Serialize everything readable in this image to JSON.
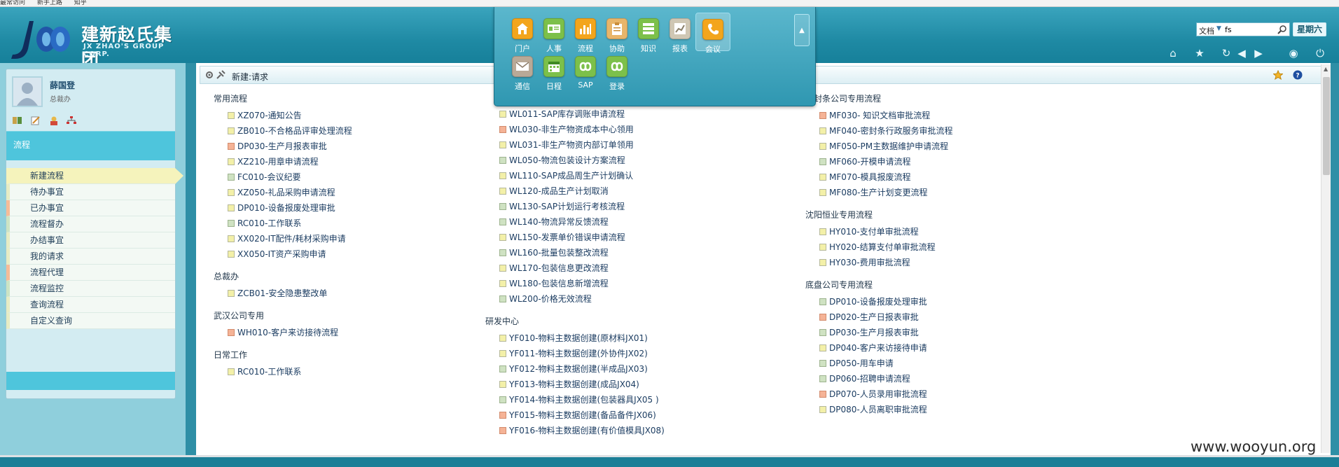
{
  "bookmarks": [
    "最常访问",
    "新手上路",
    "知乎"
  ],
  "logo": {
    "cn": "建新赵氏集团",
    "en": "JX ZHAO'S GROUP CORP."
  },
  "modules": [
    {
      "label": "门户",
      "icon": "home-icon",
      "color": "#f3a51c"
    },
    {
      "label": "人事",
      "icon": "id-card-icon",
      "color": "#7cc04a"
    },
    {
      "label": "流程",
      "icon": "bar-chart-icon",
      "color": "#f3a51c"
    },
    {
      "label": "协助",
      "icon": "clipboard-icon",
      "color": "#e8b56a"
    },
    {
      "label": "知识",
      "icon": "stack-icon",
      "color": "#7cc04a"
    },
    {
      "label": "报表",
      "icon": "report-chart-icon",
      "color": "#cfc7b4"
    },
    {
      "label": "会议",
      "icon": "phone-icon",
      "color": "#f3a51c"
    },
    {
      "label": "通信",
      "icon": "envelope-icon",
      "color": "#b9a997"
    },
    {
      "label": "日程",
      "icon": "calendar-icon",
      "color": "#7cc04a"
    },
    {
      "label": "SAP",
      "icon": "infinity-icon",
      "color": "#7cc04a"
    },
    {
      "label": "登录",
      "icon": "infinity-icon",
      "color": "#7cc04a"
    }
  ],
  "search": {
    "type": "文档",
    "value": "fs"
  },
  "weekday": "星期六",
  "toolbar_icons": [
    "home-icon",
    "star-icon",
    "refresh-icon",
    "back-icon",
    "forward-icon",
    "help-circle-icon",
    "power-icon"
  ],
  "user": {
    "name": "薛国登",
    "role": "总裁办"
  },
  "sidebar": {
    "section_title": "流程",
    "items": [
      {
        "label": "新建流程",
        "style": "active"
      },
      {
        "label": "待办事宜",
        "style": "yel"
      },
      {
        "label": "已办事宜",
        "style": "ora"
      },
      {
        "label": "流程督办",
        "style": "grn"
      },
      {
        "label": "办结事宜",
        "style": "yel"
      },
      {
        "label": "我的请求",
        "style": "yel"
      },
      {
        "label": "流程代理",
        "style": "ora"
      },
      {
        "label": "流程监控",
        "style": "grn"
      },
      {
        "label": "查询流程",
        "style": "yel"
      },
      {
        "label": "自定义查询",
        "style": "yel"
      }
    ]
  },
  "page": {
    "title": "新建:请求"
  },
  "columns": [
    [
      {
        "title": "常用流程",
        "items": [
          [
            "XZ070-通知公告",
            "y"
          ],
          [
            "ZB010-不合格品评审处理流程",
            "y"
          ],
          [
            "DP030-生产月报表审批",
            "o"
          ],
          [
            "XZ210-用章申请流程",
            "y"
          ],
          [
            "FC010-会议纪要",
            "g"
          ],
          [
            "XZ050-礼品采购申请流程",
            "y"
          ],
          [
            "DP010-设备报废处理审批",
            "y"
          ],
          [
            "RC010-工作联系",
            "g"
          ],
          [
            "XX020-IT配件/耗材采购申请",
            "y"
          ],
          [
            "XX050-IT资产采购申请",
            "y"
          ]
        ]
      },
      {
        "title": "总裁办",
        "items": [
          [
            "ZCB01-安全隐患整改单",
            "y"
          ]
        ]
      },
      {
        "title": "武汉公司专用",
        "items": [
          [
            "WH010-客户来访接待流程",
            "o"
          ]
        ]
      },
      {
        "title": "日常工作",
        "items": [
          [
            "RC010-工作联系",
            "y"
          ]
        ]
      }
    ],
    [
      {
        "title": "",
        "items": [
          [
            "WL011-SAP库存调账申请流程",
            "y"
          ],
          [
            "WL030-非生产物资成本中心领用",
            "o"
          ],
          [
            "WL031-非生产物资内部订单领用",
            "y"
          ],
          [
            "WL050-物流包装设计方案流程",
            "g"
          ],
          [
            "WL110-SAP成品周生产计划确认",
            "y"
          ],
          [
            "WL120-成品生产计划取消",
            "y"
          ],
          [
            "WL130-SAP计划运行考核流程",
            "g"
          ],
          [
            "WL140-物流异常反馈流程",
            "g"
          ],
          [
            "WL150-发票单价错误申请流程",
            "y"
          ],
          [
            "WL160-批量包装整改流程",
            "g"
          ],
          [
            "WL170-包装信息更改流程",
            "y"
          ],
          [
            "WL180-包装信息新增流程",
            "y"
          ],
          [
            "WL200-价格无效流程",
            "g"
          ]
        ]
      },
      {
        "title": "研发中心",
        "items": [
          [
            "YF010-物料主数据创建(原材料JX01)",
            "y"
          ],
          [
            "YF011-物料主数据创建(外协件JX02)",
            "y"
          ],
          [
            "YF012-物料主数据创建(半成品JX03)",
            "g"
          ],
          [
            "YF013-物料主数据创建(成品JX04)",
            "y"
          ],
          [
            "YF014-物料主数据创建(包装器具JX05 )",
            "g"
          ],
          [
            "YF015-物料主数据创建(备品备件JX06)",
            "o"
          ],
          [
            "YF016-物料主数据创建(有价值模具JX08)",
            "o"
          ]
        ]
      }
    ],
    [
      {
        "title": "密封条公司专用流程",
        "items": [
          [
            "MF030- 知识文档审批流程",
            "o"
          ],
          [
            "MF040-密封条行政服务审批流程",
            "y"
          ],
          [
            "MF050-PM主数据维护申请流程",
            "y"
          ],
          [
            "MF060-开模申请流程",
            "g"
          ],
          [
            "MF070-模具报废流程",
            "y"
          ],
          [
            "MF080-生产计划变更流程",
            "y"
          ]
        ]
      },
      {
        "title": "沈阳恒业专用流程",
        "items": [
          [
            "HY010-支付单审批流程",
            "y"
          ],
          [
            "HY020-结算支付单审批流程",
            "y"
          ],
          [
            "HY030-费用审批流程",
            "y"
          ]
        ]
      },
      {
        "title": "底盘公司专用流程",
        "items": [
          [
            "DP010-设备报废处理审批",
            "g"
          ],
          [
            "DP020-生产日报表审批",
            "o"
          ],
          [
            "DP030-生产月报表审批",
            "g"
          ],
          [
            "DP040-客户来访接待申请",
            "y"
          ],
          [
            "DP050-用车申请",
            "g"
          ],
          [
            "DP060-招聘申请流程",
            "g"
          ],
          [
            "DP070-人员录用审批流程",
            "o"
          ],
          [
            "DP080-人员离职审批流程",
            "y"
          ]
        ]
      }
    ]
  ],
  "watermark": "www.wooyun.org"
}
